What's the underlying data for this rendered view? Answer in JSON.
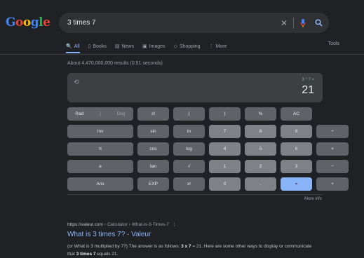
{
  "logo": [
    "G",
    "o",
    "o",
    "g",
    "l",
    "e"
  ],
  "search": {
    "query": "3 times 7",
    "clear_icon": "close-icon",
    "mic_icon": "mic-icon",
    "search_icon": "search-icon"
  },
  "tabs": [
    {
      "label": "All",
      "icon": "🔍",
      "active": true
    },
    {
      "label": "Books",
      "icon": "▯",
      "active": false
    },
    {
      "label": "News",
      "icon": "▤",
      "active": false
    },
    {
      "label": "Images",
      "icon": "▣",
      "active": false
    },
    {
      "label": "Shopping",
      "icon": "◇",
      "active": false
    },
    {
      "label": "More",
      "icon": "⋮",
      "active": false
    }
  ],
  "tools_label": "Tools",
  "result_stats": "About 4,470,000,000 results (0.51 seconds)",
  "calculator": {
    "expression": "3 * 7 =",
    "result": "21",
    "keys": [
      [
        "Rad|Deg",
        "x!",
        "(",
        ")",
        "%",
        "AC"
      ],
      [
        "Inv",
        "sin",
        "ln",
        "7",
        "8",
        "9",
        "÷"
      ],
      [
        "π",
        "cos",
        "log",
        "4",
        "5",
        "6",
        "×"
      ],
      [
        "e",
        "tan",
        "√",
        "1",
        "2",
        "3",
        "−"
      ],
      [
        "Ans",
        "EXP",
        "xʸ",
        "0",
        ".",
        "=",
        "+"
      ]
    ],
    "more_info": "More info"
  },
  "result": {
    "cite_site": "https://valeur.com",
    "cite_path": " › Calculator › What-is-3-Times-7",
    "title": "What is 3 times 7? - Valeur",
    "snippet_1": "(or What is 3 multiplied by 7?) The answer is as follows: ",
    "snippet_b1": "3 x 7",
    "snippet_2": " = 21. Here are some other ways to display or communicate that ",
    "snippet_b2": "3 times 7",
    "snippet_3": " equals 21."
  },
  "colors": {
    "background": "#202124",
    "accent": "#8ab4f8",
    "key": "#5f6368",
    "key_light": "#7e8287"
  }
}
